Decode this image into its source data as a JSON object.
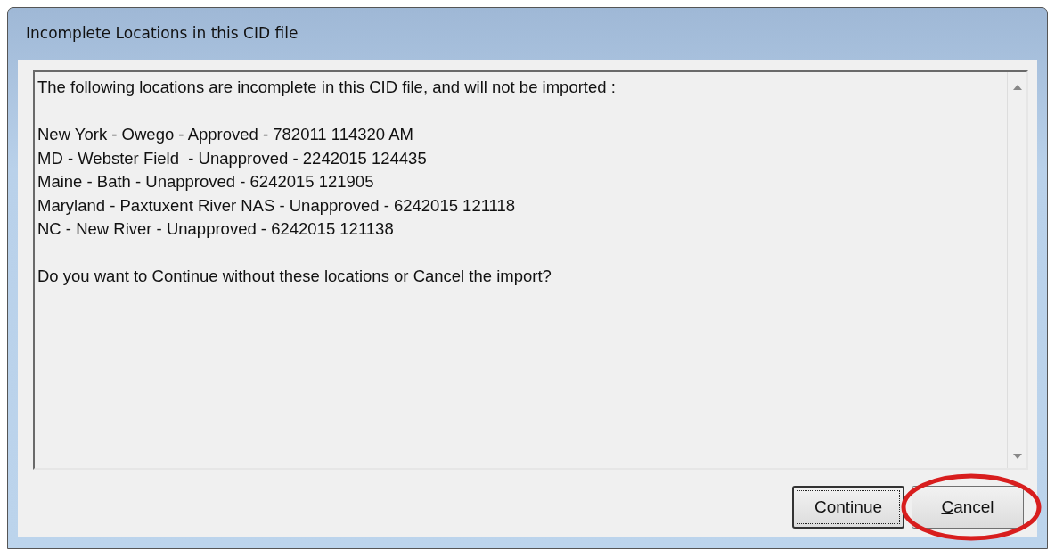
{
  "window": {
    "title": "Incomplete Locations in this CID file"
  },
  "message": {
    "intro": "The following locations are incomplete in this CID file, and will not be imported :",
    "locations": [
      {
        "text": "New York - Owego - Approved - 782011 114320 AM"
      },
      {
        "text": "MD - Webster Field  - Unapproved - 2242015 124435"
      },
      {
        "text": "Maine - Bath - Unapproved - 6242015 121905"
      },
      {
        "text": "Maryland - Paxtuxent River NAS - Unapproved - 6242015 121118"
      },
      {
        "text": "NC - New River - Unapproved - 6242015 121138"
      }
    ],
    "question": "Do you want to Continue without these locations or Cancel the import?"
  },
  "buttons": [
    {
      "label": "Continue",
      "focused": true,
      "access_key_underlined": false,
      "circled": false
    },
    {
      "label": "Cancel",
      "focused": false,
      "access_key_underlined": true,
      "circled": true
    }
  ],
  "annotation": {
    "kind": "ellipse",
    "color": "#d81e1e"
  }
}
